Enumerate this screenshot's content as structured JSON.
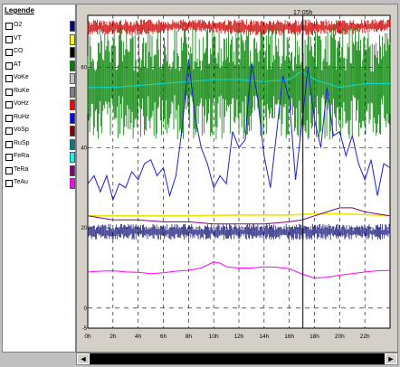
{
  "legend": {
    "title": "Legende",
    "items": [
      {
        "label": "O2",
        "color": "#000080"
      },
      {
        "label": "VT",
        "color": "#ffff00"
      },
      {
        "label": "CO",
        "color": "#000000"
      },
      {
        "label": "AT",
        "color": "#008000"
      },
      {
        "label": "VoKe",
        "color": "#c0c0c0"
      },
      {
        "label": "RuKe",
        "color": "#808080"
      },
      {
        "label": "VoHz",
        "color": "#ff0000"
      },
      {
        "label": "RuHz",
        "color": "#0000ff"
      },
      {
        "label": "VoSp",
        "color": "#800000"
      },
      {
        "label": "RuSp",
        "color": "#008080"
      },
      {
        "label": "FeRa",
        "color": "#00ffff"
      },
      {
        "label": "TeRa",
        "color": "#800080"
      },
      {
        "label": "TeAu",
        "color": "#ff00ff"
      }
    ]
  },
  "chart_data": {
    "type": "line",
    "x_unit": "h",
    "xlim": [
      0,
      24
    ],
    "ylim": [
      -5,
      73
    ],
    "x_ticks": [
      "0h",
      "2h",
      "4h",
      "6h",
      "8h",
      "10h",
      "12h",
      "14h",
      "16h",
      "18h",
      "20h",
      "22h"
    ],
    "x_tick_values": [
      0,
      2,
      4,
      6,
      8,
      10,
      12,
      14,
      16,
      18,
      20,
      22
    ],
    "y_ticks": [
      "-5",
      "0",
      "20",
      "40",
      "60"
    ],
    "y_tick_values": [
      -5,
      0,
      20,
      40,
      60
    ],
    "grid": "dashed",
    "cursor_label": "17:05h",
    "cursor_x": 17.08,
    "series": [
      {
        "name": "VoHz",
        "color": "#cc0000",
        "style": "band",
        "x": [
          0,
          4,
          8,
          12,
          16,
          20,
          24
        ],
        "low": [
          68,
          68,
          69,
          68,
          68,
          68,
          69
        ],
        "high": [
          72,
          72,
          72,
          72,
          72,
          72,
          72
        ]
      },
      {
        "name": "AT",
        "color": "#008000",
        "style": "band",
        "x": [
          0,
          4,
          8,
          12,
          16,
          20,
          24
        ],
        "low": [
          42,
          42,
          42,
          42,
          42,
          42,
          42
        ],
        "high": [
          70,
          70,
          70,
          70,
          70,
          70,
          70
        ]
      },
      {
        "name": "FeRa",
        "color": "#00e0e0",
        "style": "line",
        "x": [
          0,
          2,
          4,
          6,
          8,
          10,
          12,
          14,
          16,
          17,
          18,
          20,
          22,
          24
        ],
        "y": [
          55,
          55,
          55.5,
          56,
          56.5,
          57,
          57,
          56.5,
          57,
          59,
          57,
          55,
          56,
          56
        ]
      },
      {
        "name": "RuHz",
        "color": "#2020d0",
        "style": "line",
        "x": [
          0,
          0.5,
          1,
          1.5,
          2,
          2.5,
          3,
          3.5,
          4,
          4.5,
          5,
          5.5,
          6,
          6.5,
          7,
          7.5,
          8,
          8.5,
          9,
          9.5,
          10,
          10.5,
          11,
          11.5,
          12,
          12.5,
          13,
          13.5,
          14,
          14.5,
          15,
          15.5,
          16,
          16.5,
          17,
          17.5,
          18,
          18.5,
          19,
          19.5,
          20,
          20.5,
          21,
          21.5,
          22,
          22.5,
          23,
          23.5,
          24
        ],
        "y": [
          31,
          33,
          29,
          33,
          27,
          31,
          30,
          34,
          32,
          36,
          37,
          33,
          35,
          28,
          33,
          45,
          62,
          48,
          40,
          36,
          30,
          33,
          31,
          44,
          40,
          42,
          61,
          52,
          38,
          30,
          44,
          58,
          52,
          32,
          46,
          60,
          47,
          40,
          55,
          43,
          44,
          38,
          43,
          36,
          32,
          37,
          28,
          36,
          35
        ]
      },
      {
        "name": "VT",
        "color": "#e8e800",
        "style": "line",
        "x": [
          0,
          4,
          8,
          12,
          16,
          18,
          20,
          22,
          24
        ],
        "y": [
          23,
          23,
          23,
          23.2,
          23.2,
          23.5,
          23.5,
          23.3,
          23
        ]
      },
      {
        "name": "TeRa",
        "color": "#800080",
        "style": "line",
        "x": [
          0,
          2,
          4,
          6,
          8,
          10,
          12,
          14,
          16,
          17,
          18,
          19,
          20,
          21,
          22,
          23,
          24
        ],
        "y": [
          23,
          22,
          22,
          21.5,
          21.5,
          21,
          21,
          21,
          21.5,
          22,
          23,
          24,
          25,
          25,
          24,
          23.5,
          23
        ]
      },
      {
        "name": "RuSp",
        "color": "#202080",
        "style": "band",
        "x": [
          0,
          4,
          8,
          12,
          16,
          20,
          24
        ],
        "low": [
          17,
          17,
          17,
          17,
          17,
          17,
          17
        ],
        "high": [
          21,
          21,
          21,
          21,
          21,
          21,
          21
        ]
      },
      {
        "name": "TeAu",
        "color": "#ff00ff",
        "style": "line",
        "x": [
          0,
          1,
          2,
          3,
          4,
          5,
          6,
          7,
          8,
          9,
          10,
          10.5,
          11,
          12,
          13,
          14,
          15,
          16,
          17,
          18,
          19,
          20,
          21,
          22,
          23,
          24
        ],
        "y": [
          9,
          9.2,
          9.3,
          9,
          8.9,
          8.6,
          8.8,
          9.2,
          9.4,
          10,
          11.5,
          11.2,
          10.3,
          10,
          10,
          10.3,
          10.2,
          9.8,
          8.5,
          7.5,
          7.7,
          8.2,
          8.6,
          9,
          9.3,
          9.4
        ]
      }
    ]
  }
}
